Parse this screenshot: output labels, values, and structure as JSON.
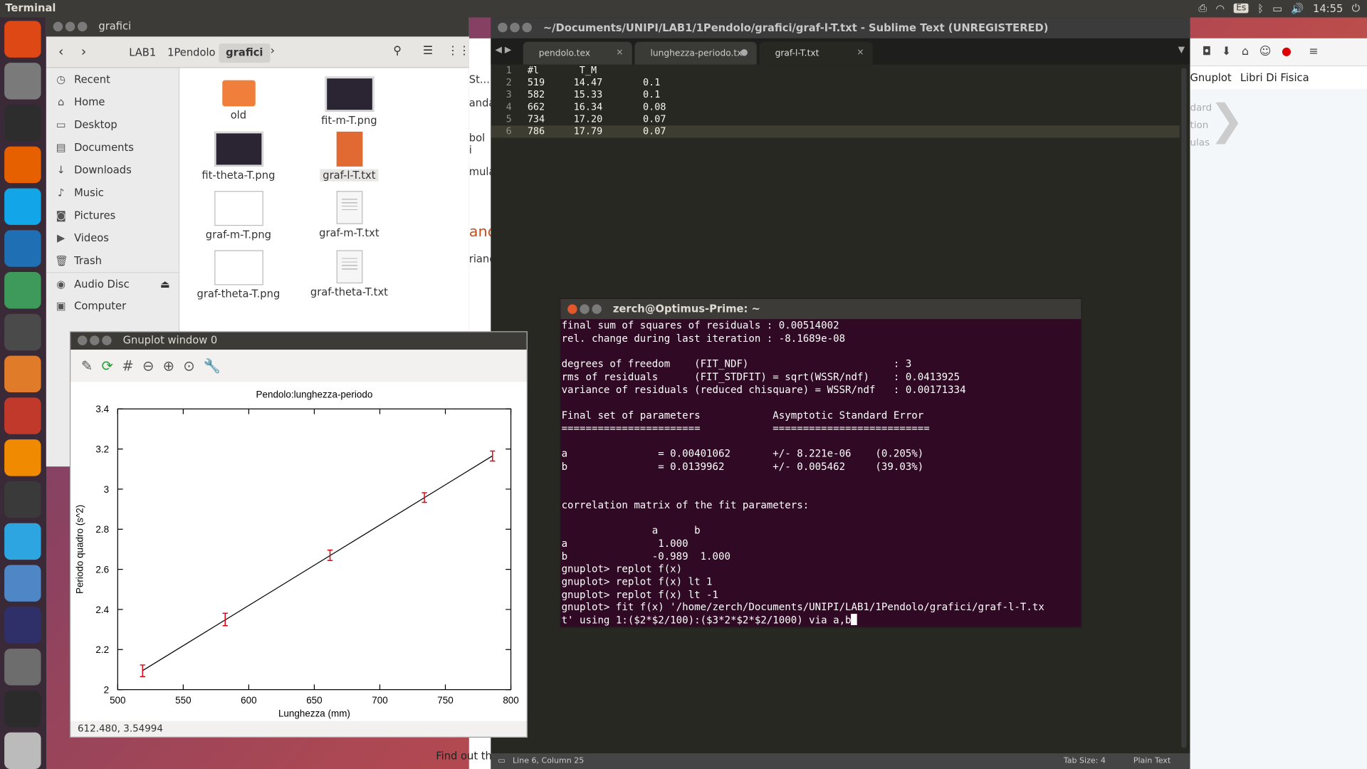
{
  "topbar": {
    "app_name": "Terminal",
    "kbd_layout": "Es",
    "time": "14:55"
  },
  "launcher": {
    "icons": [
      "ubuntu-dash",
      "files",
      "terminal",
      "firefox",
      "skype",
      "kde-connect",
      "atom",
      "sublime-text",
      "software-center",
      "system-settings",
      "vlc",
      "network-tool",
      "telegram",
      "chromium",
      "accessories",
      "gnuplot",
      "graph-app",
      "disc"
    ]
  },
  "sublime": {
    "title": "~/Documents/UNIPI/LAB1/1Pendolo/grafici/graf-l-T.txt - Sublime Text (UNREGISTERED)",
    "tabs": [
      {
        "label": "pendolo.tex"
      },
      {
        "label": "lunghezza-periodo.txt"
      },
      {
        "label": "graf-l-T.txt"
      }
    ],
    "lines": [
      {
        "n": "1",
        "text": "#l       T_M"
      },
      {
        "n": "2",
        "text": "519     14.47       0.1"
      },
      {
        "n": "3",
        "text": "582     15.33       0.1"
      },
      {
        "n": "4",
        "text": "662     16.34       0.08"
      },
      {
        "n": "5",
        "text": "734     17.20       0.07"
      },
      {
        "n": "6",
        "text": "786     17.79       0.07"
      }
    ],
    "status_pos": "Line 6, Column 25",
    "tab_size": "Tab Size: 4",
    "syntax": "Plain Text"
  },
  "firefox": {
    "bookmarks": [
      "Gnuplot",
      "Libri Di Fisica"
    ],
    "side_texts": [
      "dard",
      "tion",
      "ulas"
    ]
  },
  "web_behind": {
    "fragments": [
      "St...",
      "anda",
      "bol i",
      "mula",
      "and",
      "rianc"
    ],
    "bottom_text": "Find out the"
  },
  "nautilus": {
    "title": "grafici",
    "breadcrumb": [
      "LAB1",
      "1Pendolo",
      "grafici"
    ],
    "sidebar": [
      "Recent",
      "Home",
      "Desktop",
      "Documents",
      "Downloads",
      "Music",
      "Pictures",
      "Videos",
      "Trash",
      "Audio Disc",
      "Computer"
    ],
    "files": [
      "old",
      "fit-m-T.png",
      "fit-theta-T.png",
      "graf-l-T.txt",
      "graf-m-T.png",
      "graf-m-T.txt",
      "graf-theta-T.png",
      "graf-theta-T.txt"
    ]
  },
  "gnuplot": {
    "title": "Gnuplot window 0",
    "status": "612.480, 3.54994"
  },
  "chart_data": {
    "type": "scatter",
    "title": "Pendolo:lunghezza-periodo",
    "xlabel": "Lunghezza (mm)",
    "ylabel": "Periodo quadro (s^2)",
    "xlim": [
      500,
      800
    ],
    "ylim": [
      2,
      3.4
    ],
    "xticks": [
      "500",
      "550",
      "600",
      "650",
      "700",
      "750",
      "800"
    ],
    "yticks": [
      "2",
      "2.2",
      "2.4",
      "2.6",
      "2.8",
      "3",
      "3.2",
      "3.4"
    ],
    "series": [
      {
        "values": [
          {
            "x": 519,
            "y": 2.094,
            "err": 0.029
          },
          {
            "x": 582,
            "y": 2.35,
            "err": 0.031
          },
          {
            "x": 662,
            "y": 2.67,
            "err": 0.026
          },
          {
            "x": 734,
            "y": 2.958,
            "err": 0.024
          },
          {
            "x": 786,
            "y": 3.165,
            "err": 0.025
          }
        ]
      }
    ],
    "fit_line": {
      "x": [
        519,
        786
      ],
      "y": [
        2.095,
        3.166
      ]
    },
    "colors": {
      "points": "#e0000f",
      "line": "#000000"
    }
  },
  "terminal": {
    "title": "zerch@Optimus-Prime: ~",
    "lines": [
      "final sum of squares of residuals : 0.00514002",
      "rel. change during last iteration : -8.1689e-08",
      "",
      "degrees of freedom    (FIT_NDF)                        : 3",
      "rms of residuals      (FIT_STDFIT) = sqrt(WSSR/ndf)    : 0.0413925",
      "variance of residuals (reduced chisquare) = WSSR/ndf   : 0.00171334",
      "",
      "Final set of parameters            Asymptotic Standard Error",
      "=======================            ==========================",
      "",
      "a               = 0.00401062       +/- 8.221e-06    (0.205%)",
      "b               = 0.0139962        +/- 0.005462     (39.03%)",
      "",
      "",
      "correlation matrix of the fit parameters:",
      "",
      "               a      b",
      "a               1.000",
      "b              -0.989  1.000",
      "gnuplot> replot f(x)",
      "gnuplot> replot f(x) lt 1",
      "gnuplot> replot f(x) lt -1",
      "gnuplot> fit f(x) '/home/zerch/Documents/UNIPI/LAB1/1Pendolo/grafici/graf-l-T.tx"
    ],
    "last_line": "t' using 1:($2*$2/100):($3*2*$2*$2/1000) via a,b"
  }
}
